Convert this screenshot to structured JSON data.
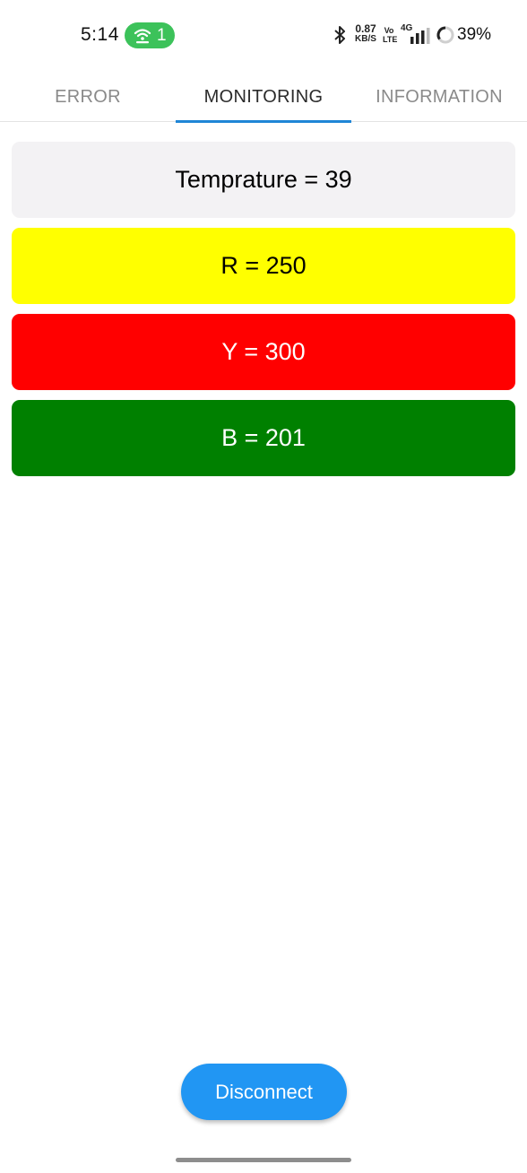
{
  "status_bar": {
    "time": "5:14",
    "hotspot_count": "1",
    "speed_value": "0.87",
    "speed_unit": "KB/S",
    "volte_top": "Vo",
    "volte_bottom": "LTE",
    "network": "4G",
    "battery": "39%",
    "icons": [
      "hotspot-icon",
      "bluetooth-icon",
      "signal-icon",
      "battery-ring-icon"
    ]
  },
  "tabs": [
    {
      "label": "ERROR",
      "active": false
    },
    {
      "label": "MONITORING",
      "active": true
    },
    {
      "label": "INFORMATION",
      "active": false
    }
  ],
  "readings": {
    "temperature": "Temprature = 39",
    "r": "R = 250",
    "y": "Y = 300",
    "b": "B = 201"
  },
  "colors": {
    "temperature_card": "#f3f2f4",
    "r_card": "#ffff00",
    "y_card": "#ff0000",
    "b_card": "#008000",
    "accent": "#1f86d6",
    "button": "#2196f3"
  },
  "disconnect_label": "Disconnect"
}
